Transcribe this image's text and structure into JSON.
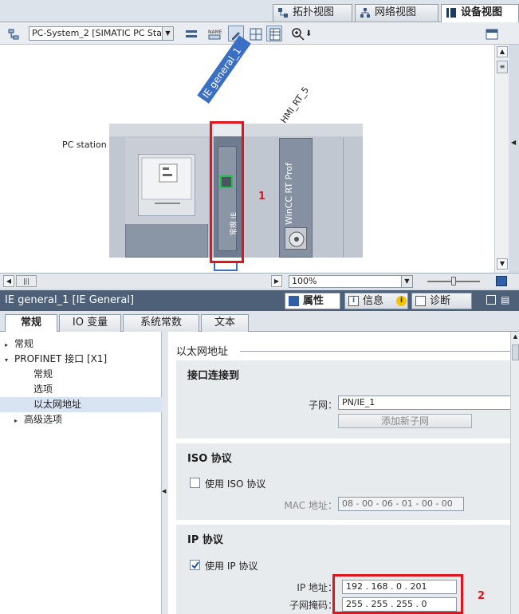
{
  "view_tabs": {
    "topology": "拓扑视图",
    "network": "网络视图",
    "device": "设备视图"
  },
  "toolbar": {
    "device_select": "PC-System_2 [SIMATIC PC Stat"
  },
  "canvas": {
    "station_label": "PC station",
    "ie_label": "IE general_1",
    "hmi_label": "HMI_RT_5",
    "wincc_label": "WinCC RT Prof",
    "card_text": "常规 IE",
    "marker1": "1"
  },
  "status_bar": {
    "zoom": "100%"
  },
  "properties": {
    "title": "IE general_1 [IE General]",
    "tabs": {
      "props": "属性",
      "info": "信息",
      "diag": "诊断"
    }
  },
  "sub_tabs": [
    "常规",
    "IO 变量",
    "系统常数",
    "文本"
  ],
  "tree": [
    {
      "label": "常规",
      "arrow": "▸",
      "level": 0
    },
    {
      "label": "PROFINET 接口 [X1]",
      "arrow": "▾",
      "level": 0
    },
    {
      "label": "常规",
      "arrow": "",
      "level": 2
    },
    {
      "label": "选项",
      "arrow": "",
      "level": 2
    },
    {
      "label": "以太网地址",
      "arrow": "",
      "level": 2,
      "selected": true
    },
    {
      "label": "高级选项",
      "arrow": "▸",
      "level": 1
    }
  ],
  "pane": {
    "heading": "以太网地址",
    "interface": {
      "title": "接口连接到",
      "subnet_label": "子网：",
      "subnet_value": "PN/IE_1",
      "add_subnet": "添加新子网"
    },
    "iso": {
      "title": "ISO 协议",
      "use_iso": "使用 ISO 协议",
      "mac_label": "MAC 地址：",
      "mac_value": "08 - 00 - 06 - 01 - 00 - 00"
    },
    "ip": {
      "title": "IP 协议",
      "use_ip": "使用 IP 协议",
      "ip_label": "IP 地址：",
      "ip_value": "192 . 168 . 0   . 201",
      "mask_label": "子网掩码：",
      "mask_value": "255 . 255 . 255 . 0"
    },
    "marker2": "2"
  },
  "colors": {
    "header_bg": "#4d6078",
    "highlight": "#e0141c",
    "selection": "#d8e4f2",
    "ie_label_bg": "#3a6fc4"
  }
}
